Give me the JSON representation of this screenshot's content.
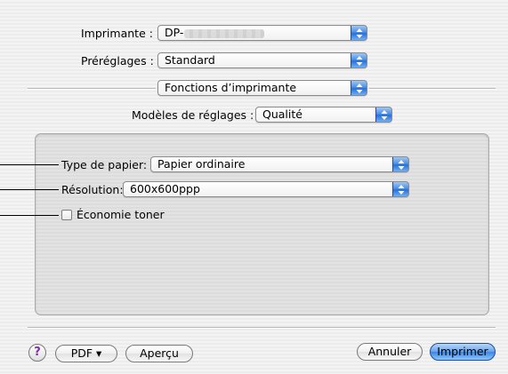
{
  "printer": {
    "label": "Imprimante :",
    "value": "DP-"
  },
  "presets": {
    "label": "Préréglages :",
    "value": "Standard"
  },
  "panel_select": {
    "value": "Fonctions d’imprimante"
  },
  "settings_model": {
    "label": "Modèles de réglages :",
    "value": "Qualité"
  },
  "paper_type": {
    "label": "Type de papier:",
    "value": "Papier ordinaire"
  },
  "resolution": {
    "label": "Résolution:",
    "value": "600x600ppp"
  },
  "toner_saving": {
    "label": "Économie toner",
    "checked": false
  },
  "footer": {
    "help_label": "?",
    "pdf_label": "PDF ▾",
    "preview_label": "Aperçu",
    "cancel_label": "Annuler",
    "print_label": "Imprimer"
  },
  "colors": {
    "accent": "#3c86e4",
    "callout_line": "#000000"
  }
}
